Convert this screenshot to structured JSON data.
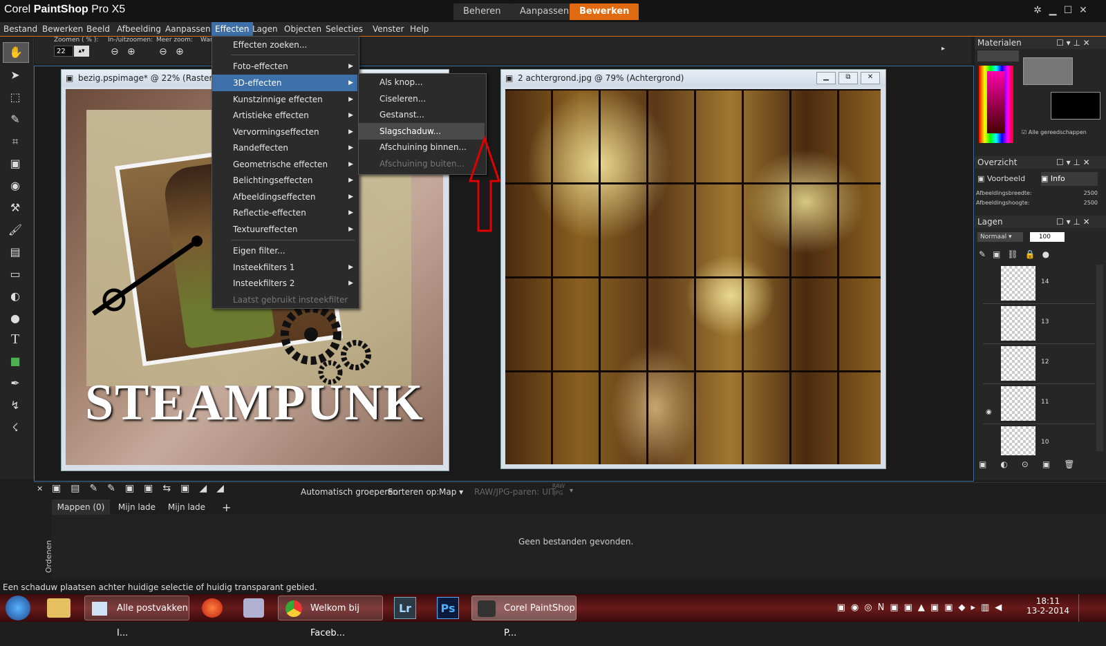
{
  "app": {
    "title_corel": "Corel ",
    "title_bold": "PaintShop",
    "title_rest": " Pro X5",
    "modes": [
      "Beheren",
      "Aanpassen",
      "Bewerken"
    ],
    "active_mode": "Bewerken"
  },
  "menubar": [
    "Bestand",
    "Bewerken",
    "Beeld",
    "Afbeelding",
    "Aanpassen",
    "Effecten",
    "Lagen",
    "Objecten",
    "Selecties",
    "Venster",
    "Help"
  ],
  "open_menu": "Effecten",
  "toolbar": {
    "zoom_label": "Zoomen ( % ):",
    "zoom_value": "22",
    "in_out_label": "In-/uitzoomen:",
    "more_zoom_label": "Meer zoom:",
    "truncated_label": "War"
  },
  "effects_menu": {
    "items": [
      {
        "label": "Effecten zoeken...",
        "submenu": false
      },
      {
        "label": "Foto-effecten",
        "submenu": true
      },
      {
        "label": "3D-effecten",
        "submenu": true,
        "highlight": true
      },
      {
        "label": "Kunstzinnige effecten",
        "submenu": true
      },
      {
        "label": "Artistieke effecten",
        "submenu": true
      },
      {
        "label": "Vervormingseffecten",
        "submenu": true
      },
      {
        "label": "Randeffecten",
        "submenu": true
      },
      {
        "label": "Geometrische effecten",
        "submenu": true
      },
      {
        "label": "Belichtingseffecten",
        "submenu": true
      },
      {
        "label": "Afbeeldingseffecten",
        "submenu": true
      },
      {
        "label": "Reflectie-effecten",
        "submenu": true
      },
      {
        "label": "Textuureffecten",
        "submenu": true
      },
      {
        "label": "Eigen filter...",
        "submenu": false
      },
      {
        "label": "Insteekfilters 1",
        "submenu": true
      },
      {
        "label": "Insteekfilters 2",
        "submenu": true
      },
      {
        "label": "Laatst gebruikt insteekfilter",
        "submenu": false,
        "disabled": true
      }
    ]
  },
  "submenu_3d": {
    "items": [
      {
        "label": "Als knop..."
      },
      {
        "label": "Ciseleren..."
      },
      {
        "label": "Gestanst..."
      },
      {
        "label": "Slagschaduw...",
        "selected": true
      },
      {
        "label": "Afschuining binnen..."
      },
      {
        "label": "Afschuining buiten...",
        "disabled": true
      }
    ]
  },
  "doc1": {
    "title": "bezig.pspimage* @  22% (Raster 3)",
    "overlay_text": "STEAMPUNK"
  },
  "doc2": {
    "title": "2 achtergrond.jpg @  79% (Achtergrond)"
  },
  "panels": {
    "materials": "Materialen",
    "all_tools": "Alle gereedschappen",
    "overview": "Overzicht",
    "preview_tab": "Voorbeeld",
    "info_tab": "Info",
    "info_rows": [
      {
        "label": "Afbeeldingsbreedte:",
        "value": "2500"
      },
      {
        "label": "Afbeeldingshoogte:",
        "value": "2500"
      }
    ],
    "layers": "Lagen",
    "blend_mode": "Normaal",
    "opacity": "100",
    "layer_numbers": [
      "14",
      "13",
      "12",
      "11",
      "10"
    ]
  },
  "organizer": {
    "auto_group": "Automatisch groeperen",
    "sort_label": "Sorteren op:",
    "sort_value": "Map",
    "raw_label": "RAW/JPG-paren: UIT",
    "raw_icon_top": "RAW",
    "raw_icon_bottom": "JPG",
    "tabs": [
      "Mappen (0)",
      "Mijn lade",
      "Mijn lade"
    ],
    "add_tab": "+",
    "empty_msg": "Geen bestanden gevonden.",
    "side_label": "Ordenen"
  },
  "status": "Een schaduw plaatsen achter huidige selectie of huidig transparant gebied.",
  "taskbar": {
    "buttons": [
      {
        "label": "Alle postvakken I..."
      },
      {
        "label": "Welkom bij Faceb..."
      },
      {
        "label": "Lr"
      },
      {
        "label": "Ps"
      },
      {
        "label": "Corel PaintShop P..."
      }
    ],
    "time": "18:11",
    "date": "13-2-2014"
  },
  "colors": {
    "accent": "#e06a10",
    "highlight": "#3d6fa8",
    "arrow": "#e00000"
  }
}
